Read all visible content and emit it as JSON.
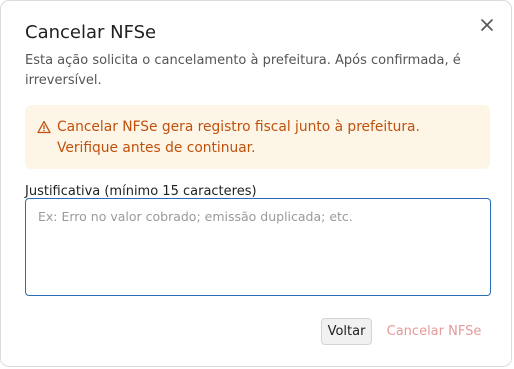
{
  "dialog": {
    "title": "Cancelar NFSe",
    "description": "Esta ação solicita o cancelamento à prefeitura. Após confirmada, é irreversível.",
    "close_icon": "close-icon"
  },
  "warning": {
    "icon": "warning-triangle-icon",
    "text": "Cancelar NFSe gera registro fiscal junto à prefeitura. Verifique antes de continuar.",
    "color": "#c0500e",
    "background": "#fdf6e6"
  },
  "justification": {
    "label": "Justificativa (mínimo 15 caracteres)",
    "value": "",
    "placeholder": "Ex: Erro no valor cobrado; emissão duplicada; etc."
  },
  "actions": {
    "back_label": "Voltar",
    "cancel_label": "Cancelar NFSe",
    "cancel_disabled": true,
    "cancel_color": "#e49a9a"
  }
}
